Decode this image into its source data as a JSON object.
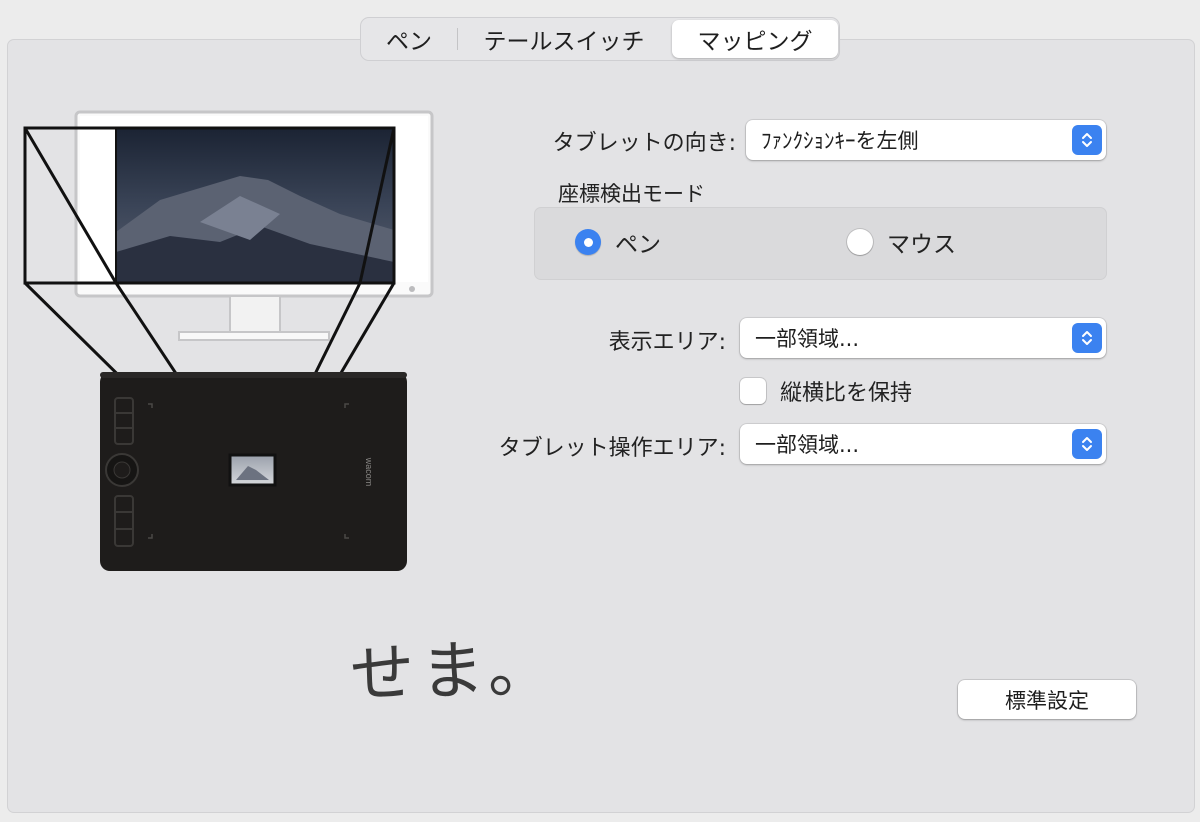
{
  "tabs": [
    {
      "label": "ペン",
      "selected": false
    },
    {
      "label": "テールスイッチ",
      "selected": false
    },
    {
      "label": "マッピング",
      "selected": true
    }
  ],
  "tablet_orientation": {
    "label": "タブレットの向き:",
    "value": "ﾌｧﾝｸｼｮﾝｷｰを左側"
  },
  "coordinate_mode": {
    "title": "座標検出モード",
    "options": [
      {
        "label": "ペン",
        "selected": true
      },
      {
        "label": "マウス",
        "selected": false
      }
    ]
  },
  "display_area": {
    "label": "表示エリア:",
    "value": "一部領域..."
  },
  "keep_aspect": {
    "label": "縦横比を保持",
    "checked": false
  },
  "tablet_area": {
    "label": "タブレット操作エリア:",
    "value": "一部領域..."
  },
  "default_button": {
    "label": "標準設定"
  },
  "handwritten_note": "せま。",
  "tablet_brand": "wacom",
  "colors": {
    "accent": "#3b82f0",
    "panel": "#e3e3e5",
    "tablet": "#1e1c1b"
  }
}
